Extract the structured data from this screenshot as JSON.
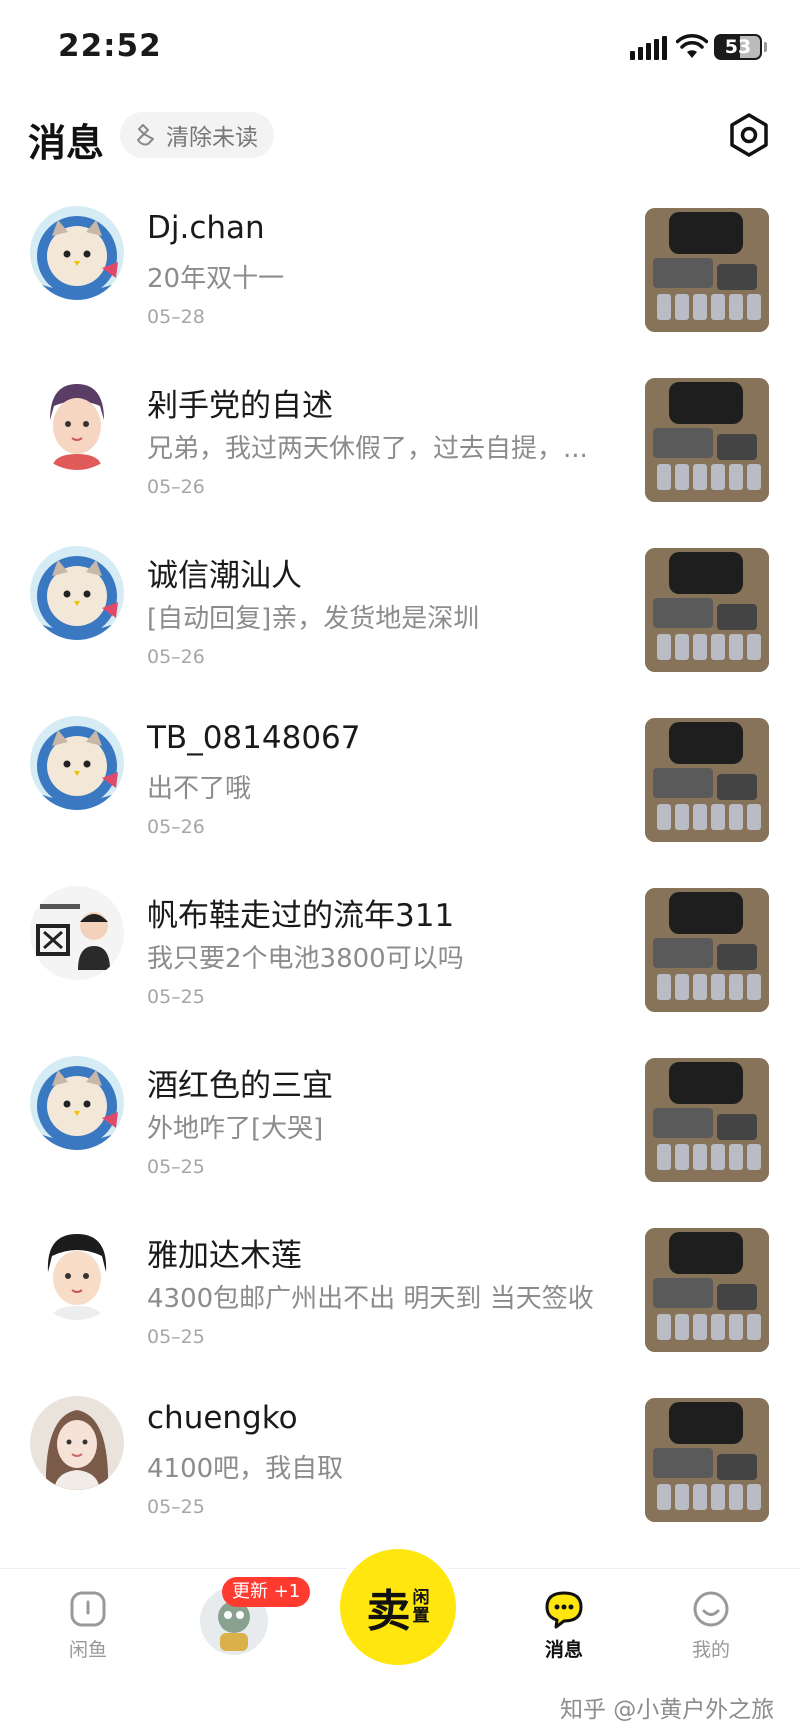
{
  "status_bar": {
    "time": "22:52",
    "battery": "53"
  },
  "header": {
    "title": "消息",
    "clear_unread": "清除未读"
  },
  "messages": [
    {
      "name": "Dj.chan",
      "preview": "20年双十一",
      "date": "05–28",
      "avatar": "cat-astronaut"
    },
    {
      "name": "剁手党的自述",
      "preview": "兄弟，我过两天休假了，过去自提，...",
      "date": "05–26",
      "avatar": "cartoon-boy"
    },
    {
      "name": "诚信潮汕人",
      "preview": "[自动回复]亲，发货地是深圳",
      "date": "05–26",
      "avatar": "cat-astronaut"
    },
    {
      "name": "TB_08148067",
      "preview": "出不了哦",
      "date": "05–26",
      "avatar": "cat-astronaut"
    },
    {
      "name": "帆布鞋走过的流年311",
      "preview": "我只要2个电池3800可以吗",
      "date": "05–25",
      "avatar": "text-sticker"
    },
    {
      "name": "酒红色的三宜",
      "preview": "外地咋了[大哭]",
      "date": "05–25",
      "avatar": "cat-astronaut"
    },
    {
      "name": "雅加达木莲",
      "preview": "4300包邮广州出不出 明天到 当天签收",
      "date": "05–25",
      "avatar": "cartoon-boy"
    },
    {
      "name": "chuengko",
      "preview": "4100吧，我自取",
      "date": "05–25",
      "avatar": "photo-woman"
    }
  ],
  "tab_bar": {
    "home": "闲鱼",
    "update_badge": "更新 +1",
    "sell_main": "卖",
    "sell_sub_1": "闲",
    "sell_sub_2": "置",
    "messages": "消息",
    "mine": "我的"
  },
  "watermark": "知乎 @小黄户外之旅",
  "colors": {
    "accent": "#ffe60f",
    "badge": "#ff3b30",
    "muted_text": "#8c8c8c"
  }
}
